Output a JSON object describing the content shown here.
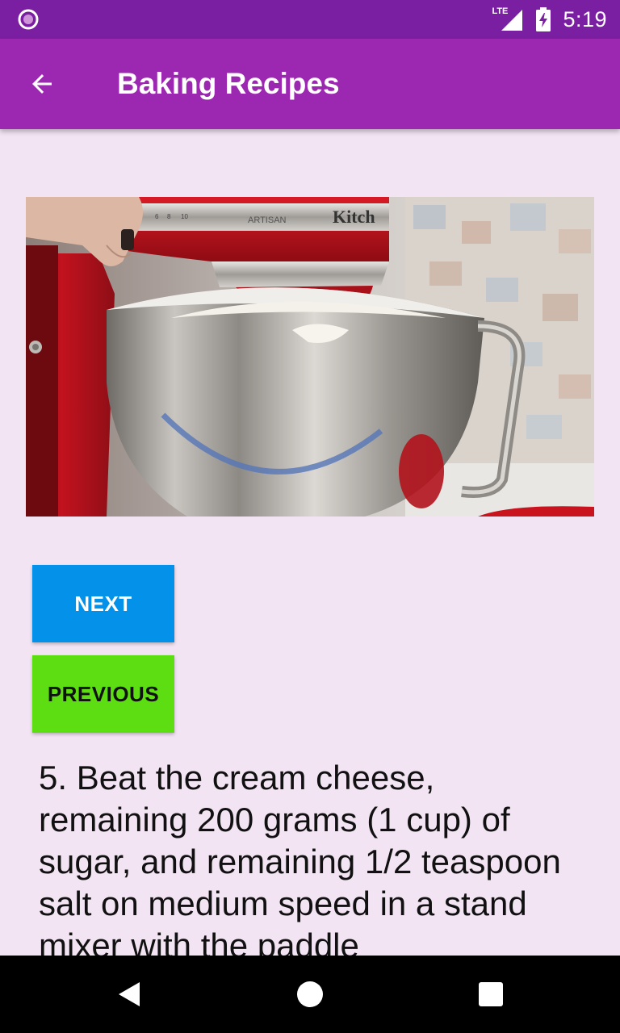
{
  "status_bar": {
    "time": "5:19",
    "network_label": "LTE",
    "left_icon": "notification-circle-icon",
    "signal_icon": "signal-icon",
    "battery_icon": "battery-charging-icon",
    "bar_color": "#7B1FA2"
  },
  "app_bar": {
    "title": "Baking Recipes",
    "back_icon": "arrow-back-icon",
    "bar_color": "#9C27B0"
  },
  "video": {
    "visible_text": [
      "ARTISAN",
      "Kitch",
      "6",
      "8",
      "10"
    ]
  },
  "buttons": {
    "next_label": "NEXT",
    "next_color": "#0391EA",
    "previous_label": "PREVIOUS",
    "previous_color": "#5CDE12"
  },
  "step": {
    "description": "5. Beat the cream cheese, remaining 200 grams (1 cup) of sugar, and remaining 1/2 teaspoon salt on medium speed in a stand mixer with the paddle"
  },
  "nav_bar": {
    "back_icon": "nav-back-icon",
    "home_icon": "nav-home-icon",
    "recents_icon": "nav-recents-icon"
  },
  "colors": {
    "background": "#F3E4F4"
  }
}
